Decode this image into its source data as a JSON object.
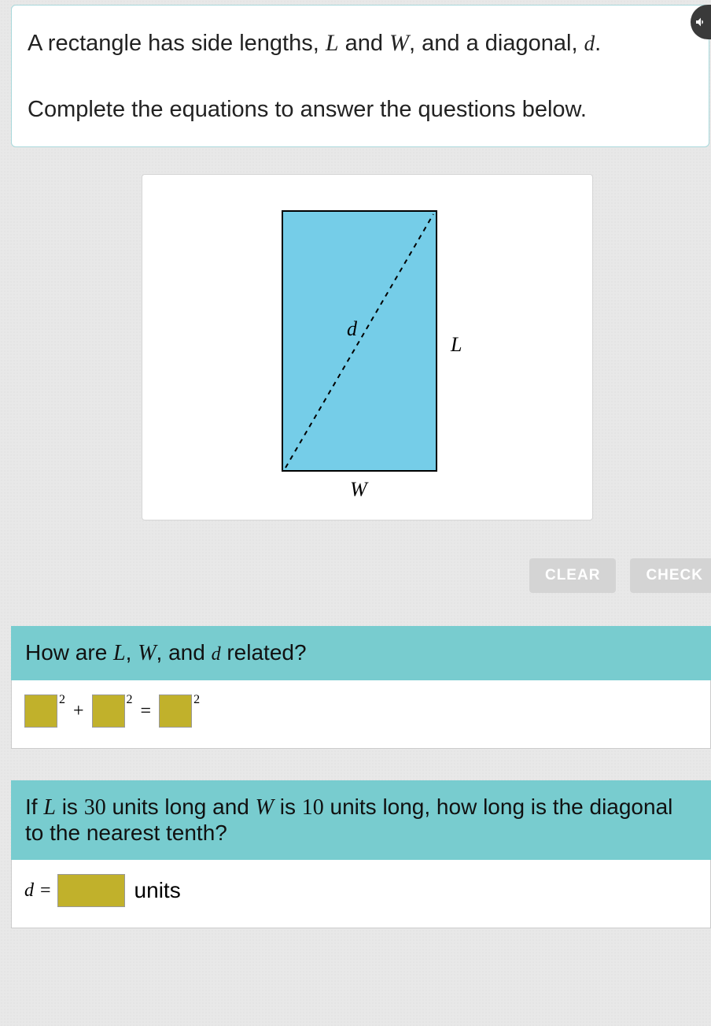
{
  "problem": {
    "line1_pre": "A rectangle has side lengths, ",
    "var_L": "L",
    "line1_mid1": " and ",
    "var_W": "W",
    "line1_mid2": ", and a diagonal, ",
    "var_d": "d",
    "line1_end": ".",
    "line2": "Complete the equations to answer the questions below."
  },
  "figure": {
    "label_d": "d",
    "label_L": "L",
    "label_W": "W"
  },
  "buttons": {
    "clear": "CLEAR",
    "check": "CHECK"
  },
  "q1": {
    "prompt_pre": "How are ",
    "var_L": "L",
    "sep1": ", ",
    "var_W": "W",
    "sep2": ", and ",
    "var_d": "d",
    "prompt_post": " related?",
    "exp": "2",
    "plus": "+",
    "equals": "="
  },
  "q2": {
    "prompt_pre": "If ",
    "var_L": "L",
    "text_is1": " is ",
    "val_L": "30",
    "text_mid1": " units long and ",
    "var_W": "W",
    "text_is2": " is ",
    "val_W": "10",
    "text_mid2": " units long, how long is the diagonal to the nearest tenth?",
    "var_d": "d",
    "equals": "=",
    "units": "units"
  }
}
